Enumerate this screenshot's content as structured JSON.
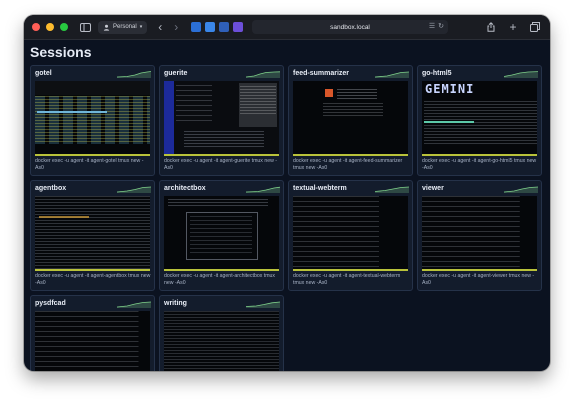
{
  "browser": {
    "profile_label": "Personal",
    "url": "sandbox.local"
  },
  "page": {
    "title": "Sessions"
  },
  "sessions": [
    {
      "name": "gotel",
      "command": "docker exec -u agent -it agent-gotel tmux new -As0"
    },
    {
      "name": "guerite",
      "command": "docker exec -u agent -it agent-guerite tmux new -As0"
    },
    {
      "name": "feed-summarizer",
      "command": "docker exec -u agent -it agent-feed-summarizer tmux new -As0"
    },
    {
      "name": "go-html5",
      "command": "docker exec -u agent -it agent-go-html5 tmux new -As0"
    },
    {
      "name": "agentbox",
      "command": "docker exec -u agent -it agent-agentbox tmux new -As0"
    },
    {
      "name": "architectbox",
      "command": "docker exec -u agent -it agent-architectbox tmux new -As0"
    },
    {
      "name": "textual-webterm",
      "command": "docker exec -u agent -it agent-textual-webterm tmux new -As0"
    },
    {
      "name": "viewer",
      "command": "docker exec -u agent -it agent-viewer tmux new -As0"
    },
    {
      "name": "pysdfcad",
      "command": ""
    },
    {
      "name": "writing",
      "command": ""
    }
  ],
  "thumbnail_text": {
    "go_html5_banner": "GEMINI"
  },
  "colors": {
    "window_bg": "#0b1220",
    "card_bg": "#131c2c",
    "card_border": "#253249",
    "sparkline": "#7fd18a",
    "traffic_red": "#ff5f57",
    "traffic_yellow": "#febc2e",
    "traffic_green": "#28c840"
  },
  "icons": {
    "sidebar": "sidebar-toggle-icon",
    "back": "chevron-left-icon",
    "forward": "chevron-right-icon",
    "share": "share-icon",
    "new_tab": "plus-icon",
    "tabs": "tab-overview-icon"
  }
}
